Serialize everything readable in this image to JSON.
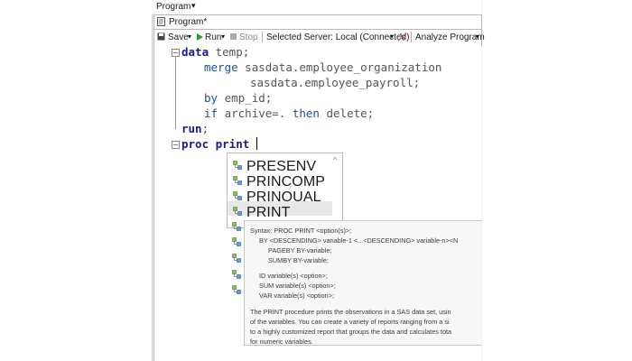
{
  "header": {
    "menu_label": "Program",
    "menu_caret": "▾"
  },
  "tab": {
    "label": "Program*",
    "icon": "program-file-icon"
  },
  "toolbar": {
    "save": "Save",
    "run": "Run",
    "stop": "Stop",
    "server": "Selected Server: Local (Connected)",
    "analyze": "Analyze Program",
    "dropdown": "▾"
  },
  "code": {
    "line1_kw": "data",
    "line1_rest": " temp;",
    "line2_kw": "merge",
    "line2_rest": " sasdata.employee_organization",
    "line3": "sasdata.employee_payroll;",
    "line4_kw": "by",
    "line4_rest": " emp_id;",
    "line5_kw": "if",
    "line5_rest": " archive=. ",
    "line5_kw2": "then",
    "line5_rest2": " delete;",
    "line6_kw": "run",
    "line6_rest": ";",
    "line7": "proc print"
  },
  "completion": {
    "items": [
      "PRESENV",
      "PRINCOMP",
      "PRINQUAL",
      "PRINT"
    ],
    "selected": "PRINT",
    "icon": "procedure-icon"
  },
  "tooltip": {
    "lines": [
      "Syntax: PROC PRINT <option(s)>;",
      "BY <DESCENDING> variable-1 <...<DESCENDING> variable-n><N",
      "PAGEBY BY-variable;",
      "SUMBY BY-variable;",
      "",
      "ID variable(s) <option>;",
      "SUM variable(s) <option>;",
      "VAR variable(s) <option>;",
      "",
      "The PRINT procedure prints the observations in a SAS data set, usin",
      "of the variables. You can create a variety of reports ranging from a si",
      "to a highly customized report that groups the data and calculates tota",
      "for numeric variables."
    ]
  },
  "colors": {
    "keyword": "#1a1a8c",
    "run_arrow": "#2e9a2e",
    "stop": "#9a9a9a"
  }
}
